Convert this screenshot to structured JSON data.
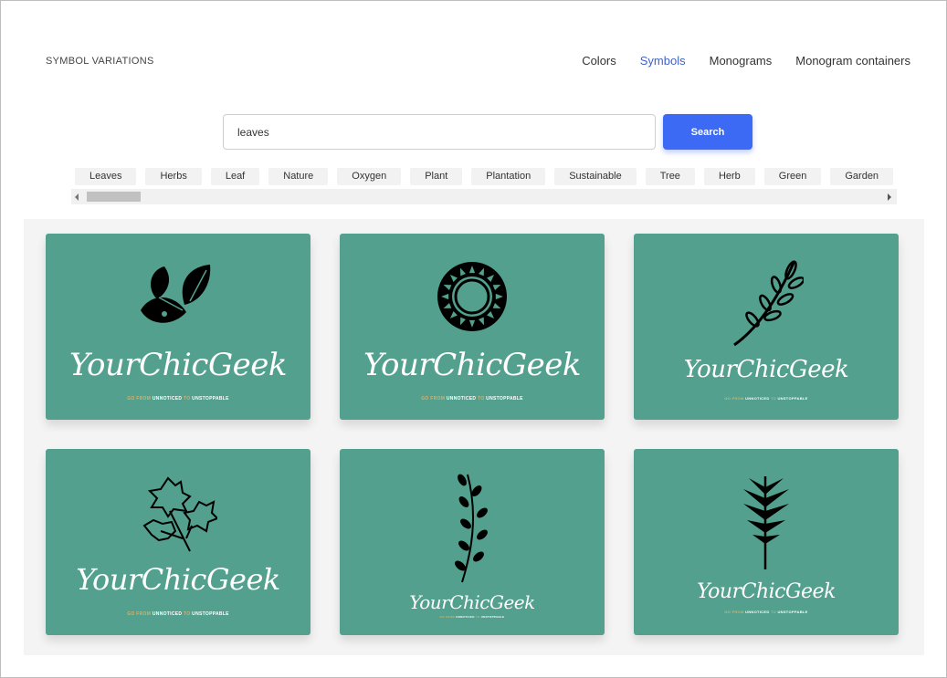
{
  "section_title": "SYMBOL VARIATIONS",
  "tabs": [
    {
      "label": "Colors"
    },
    {
      "label": "Symbols"
    },
    {
      "label": "Monograms"
    },
    {
      "label": "Monogram containers"
    }
  ],
  "active_tab": "Symbols",
  "search": {
    "value": "leaves",
    "button_label": "Search"
  },
  "tags": [
    "Leaves",
    "Herbs",
    "Leaf",
    "Nature",
    "Oxygen",
    "Plant",
    "Plantation",
    "Sustainable",
    "Tree",
    "Herb",
    "Green",
    "Garden"
  ],
  "cards": [
    {
      "brand": "YourChicGeek",
      "tagline": {
        "gold": "GO FROM",
        "white_1": "UNNOTICED",
        "gold_2": "TO",
        "white_2": "UNSTOPPABLE"
      },
      "symbol": "three-leaves-icon"
    },
    {
      "brand": "YourChicGeek",
      "tagline": {
        "gold": "GO FROM",
        "white_1": "UNNOTICED",
        "gold_2": "TO",
        "white_2": "UNSTOPPABLE"
      },
      "symbol": "mandala-wreath-icon"
    },
    {
      "brand": "YourChicGeek",
      "tagline": {
        "gold": "GO FROM",
        "white_1": "UNNOTICED",
        "gold_2": "TO",
        "white_2": "UNSTOPPABLE"
      },
      "symbol": "olive-branch-icon"
    },
    {
      "brand": "YourChicGeek",
      "tagline": {
        "gold": "GO FROM",
        "white_1": "UNNOTICED",
        "gold_2": "TO",
        "white_2": "UNSTOPPABLE"
      },
      "symbol": "ivy-leaves-icon"
    },
    {
      "brand": "YourChicGeek",
      "tagline": {
        "gold": "GO FROM",
        "white_1": "UNNOTICED",
        "gold_2": "TO",
        "white_2": "UNSTOPPABLE"
      },
      "symbol": "fern-sprig-icon"
    },
    {
      "brand": "YourChicGeek",
      "tagline": {
        "gold": "GO FROM",
        "white_1": "UNNOTICED",
        "gold_2": "TO",
        "white_2": "UNSTOPPABLE"
      },
      "symbol": "palm-frond-icon"
    }
  ],
  "colors": {
    "card": "#52a08d",
    "accent": "#3d6af5",
    "active_tab": "#3f63c9",
    "tagline_gold": "#d1b26d"
  }
}
